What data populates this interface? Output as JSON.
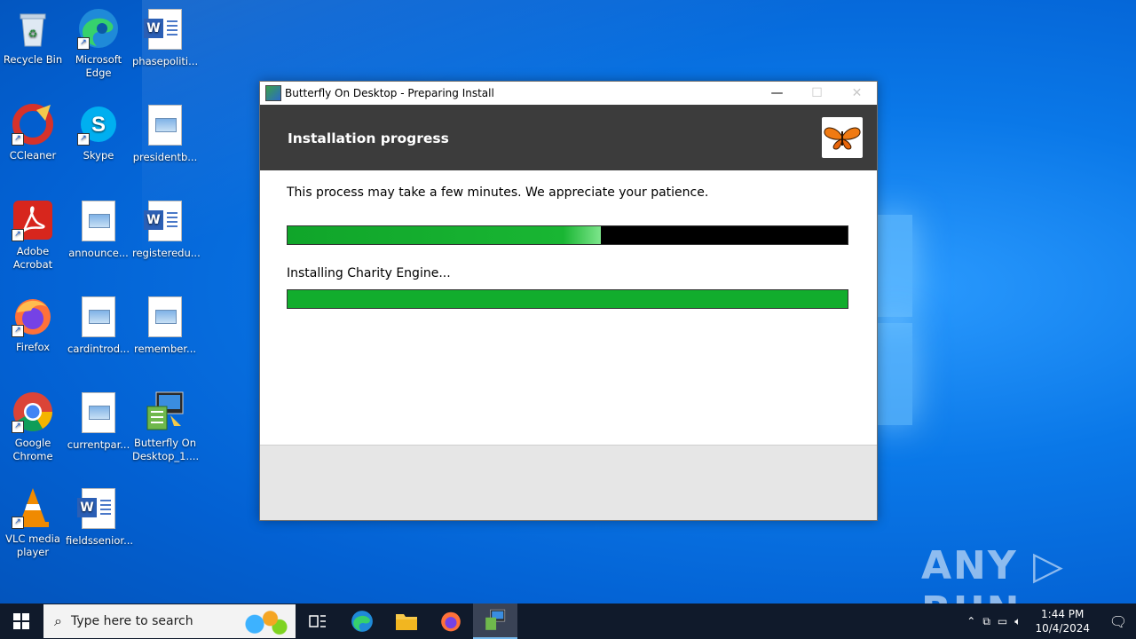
{
  "desktop": {
    "icons": [
      {
        "label": "Recycle Bin"
      },
      {
        "label": "Microsoft Edge"
      },
      {
        "label": "phasepoliti..."
      },
      {
        "label": "CCleaner"
      },
      {
        "label": "Skype"
      },
      {
        "label": "presidentb..."
      },
      {
        "label": "Adobe Acrobat"
      },
      {
        "label": "announce..."
      },
      {
        "label": "registeredu..."
      },
      {
        "label": "Firefox"
      },
      {
        "label": "cardintrod..."
      },
      {
        "label": "remember..."
      },
      {
        "label": "Google Chrome"
      },
      {
        "label": "currentpar..."
      },
      {
        "label": "Butterfly On Desktop_1...."
      },
      {
        "label": "VLC media player"
      },
      {
        "label": "fieldssenior..."
      }
    ]
  },
  "window": {
    "title": "Butterfly On Desktop - Preparing Install",
    "header_title": "Installation progress",
    "message": "This process may take a few minutes. We appreciate your patience.",
    "status_text": "Installing Charity Engine...",
    "overall_progress": 0.56,
    "step_progress": 1.0,
    "min_glyph": "—",
    "max_glyph": "☐",
    "close_glyph": "✕"
  },
  "watermark": "ANY ▷ RUN",
  "taskbar": {
    "search_placeholder": "Type here to search",
    "time": "1:44 PM",
    "date": "10/4/2024"
  },
  "colors": {
    "header_bg": "#3c3c3c",
    "progress_green": "#12ad2d",
    "taskbar_bg": "#101a2b"
  }
}
